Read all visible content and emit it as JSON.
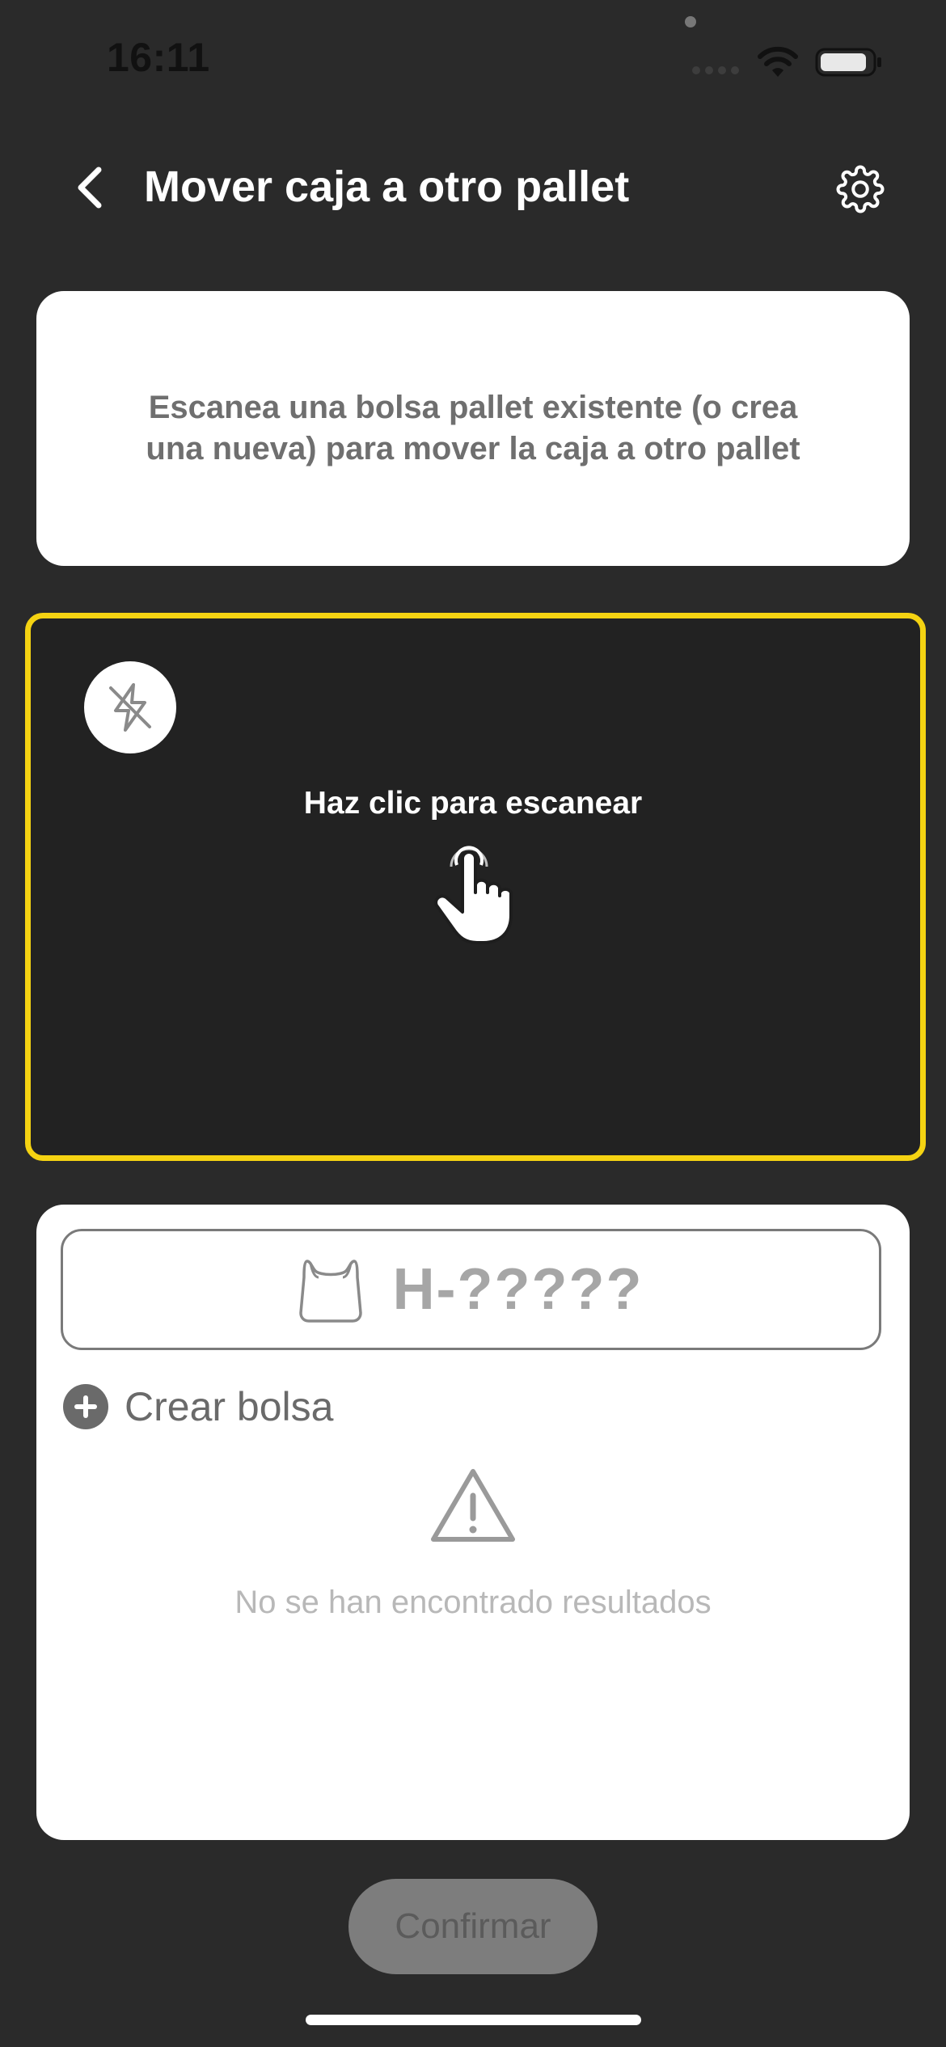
{
  "status_bar": {
    "time": "16:11"
  },
  "header": {
    "title": "Mover caja a otro pallet",
    "back_icon": "chevron-left-icon",
    "settings_icon": "gear-icon"
  },
  "instruction": {
    "text": "Escanea una bolsa pallet existente (o crea una nueva) para mover la caja a otro pallet"
  },
  "scanner": {
    "label": "Haz clic para escanear",
    "flash_icon": "flash-off-icon",
    "hand_icon": "hand-pointer-icon",
    "border_color": "#f5d312"
  },
  "results": {
    "bag_code": "H-?????",
    "bag_icon": "bag-icon",
    "create_label": "Crear bolsa",
    "empty_text": "No se han encontrado resultados"
  },
  "footer": {
    "confirm_label": "Confirmar"
  }
}
